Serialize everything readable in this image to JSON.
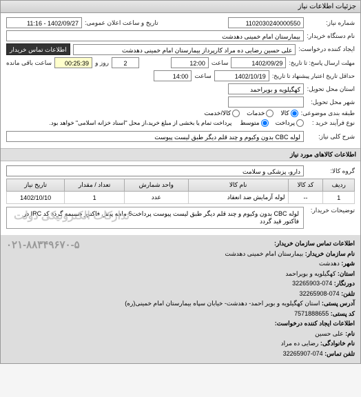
{
  "panel_title": "جزئیات اطلاعات نیاز",
  "header": {
    "req_no_label": "شماره نیاز:",
    "req_no": "1102030240000550",
    "pub_date_label": "تاریخ و ساعت اعلان عمومی:",
    "pub_date": "1402/09/27 - 11:16",
    "buyer_label": "نام دستگاه خریدار:",
    "buyer": "بیمارستان امام خمینی دهدشت",
    "creator_label": "ایجاد کننده درخواست:",
    "creator": "علی حسین رضایی ده مراد کارپرداز بیمارستان امام خمینی دهدشت",
    "contact_btn": "اطلاعات تماس خریدار",
    "deadline_label": "مهلت ارسال پاسخ:",
    "deadline_sub": "تا تاریخ:",
    "deadline_date": "1402/09/29",
    "deadline_time_lbl": "ساعت",
    "deadline_time": "12:00",
    "days_remain": "2",
    "days_lbl": "روز و",
    "time_remain": "00:25:39",
    "time_lbl": "ساعت باقی مانده",
    "validity_label": "حداقل تاریخ اعتبار",
    "validity_sub": "پیشنهاد تا تاریخ:",
    "validity_date": "1402/10/19",
    "validity_time_lbl": "ساعت",
    "validity_time": "14:00",
    "province_lbl": "استان محل تحویل:",
    "province": "کهگیلویه و بویراحمد",
    "city_lbl": "شهر محل تحویل:",
    "city": "",
    "group_lbl": "طبقه بندی موضوعی:",
    "group_kala": "کالا",
    "group_khadamat": "خدمات",
    "group_both": "کالا/خدمت",
    "pay_lbl": "نوع فرآیند خرید :",
    "pay_radio1": "پرداخت",
    "pay_radio2": "متوسط",
    "pay_note": "پرداخت تمام یا بخشی از مبلغ خرید،از محل \"اسناد خزانه اسلامی\" خواهد بود.",
    "desc_lbl": "شرح کلی نیاز:",
    "desc": "لوله CBC بدون وکیوم و چند قلم دیگر طبق لیست پیوست"
  },
  "items_section": "اطلاعات کالاهای مورد نیاز",
  "group_field_lbl": "گروه کالا:",
  "group_field": "دارو، پزشکی و سلامت",
  "table": {
    "headers": [
      "ردیف",
      "کد کالا",
      "نام کالا",
      "واحد شمارش",
      "تعداد / مقدار",
      "تاریخ نیاز"
    ],
    "rows": [
      [
        "1",
        "--",
        "لوله آزمایش ضد انعقاد",
        "عدد",
        "1",
        "1402/10/10"
      ]
    ]
  },
  "notes_lbl": "توضیحات خریدار:",
  "notes": "لوله CBC بدون وکیوم و چند قلم دیگر طبق لیست پیوست پرداخت6 ماهه پیش فاکتور ضمیمه گردد کد IRC در فاکتور قید گردد",
  "watermark": "تدارکات الکترونیکی دولت",
  "contact": {
    "title": "اطلاعات تماس سازمان خریدار:",
    "org_lbl": "نام سازمان خریدار:",
    "org": "بیمارستان امام خمینی دهدشت",
    "city_lbl": "شهر:",
    "city": "دهدشت",
    "prov_lbl": "استان:",
    "prov": "کهگیلویه و بویراحمد",
    "fax_lbl": "دورنگار:",
    "fax": "074-32265903",
    "tel_lbl": "تلفن:",
    "tel": "074-32265908",
    "addr_lbl": "آدرس پستی:",
    "addr": "استان کهگیلویه و بویر احمد- دهدشت- خیابان سپاه بیمارستان امام خمینی(ره)",
    "post_lbl": "کد پستی:",
    "post": "7571888655",
    "creator_title": "اطلاعات ایجاد کننده درخواست:",
    "name_lbl": "نام:",
    "name": "علی حسین",
    "family_lbl": "نام خانوادگی:",
    "family": "رضایی ده مراد",
    "ctel_lbl": "تلفن تماس:",
    "ctel": "074-32265907",
    "phone_wm": "۰۲۱-۸۸۳۴۹۶۷۰-۵"
  }
}
